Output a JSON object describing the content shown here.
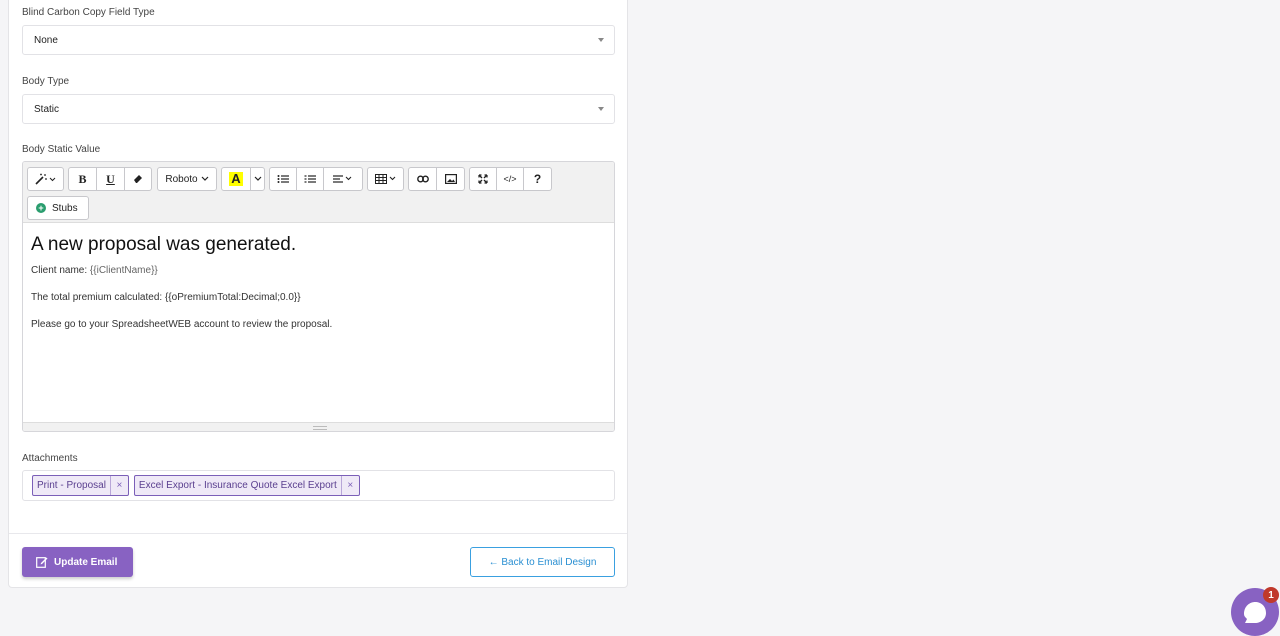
{
  "bcc": {
    "label": "Blind Carbon Copy Field Type",
    "value": "None"
  },
  "body_type": {
    "label": "Body Type",
    "value": "Static"
  },
  "body_static": {
    "label": "Body Static Value",
    "toolbar": {
      "font": "Roboto",
      "highlight_letter": "A",
      "help": "?",
      "code": "</>",
      "bold": "B",
      "underline": "U",
      "stubs": "Stubs"
    },
    "content": {
      "heading": "A new proposal was generated.",
      "line1_prefix": "Client name: ",
      "line1_var": "{{iClientName}}",
      "line2": "The total premium calculated: {{oPremiumTotal:Decimal;0.0}}",
      "line3": "Please go to your SpreadsheetWEB account to review the proposal."
    }
  },
  "attachments": {
    "label": "Attachments",
    "items": [
      {
        "label": "Print - Proposal",
        "remove": "×"
      },
      {
        "label": "Excel Export - Insurance Quote Excel Export",
        "remove": "×"
      }
    ]
  },
  "actions": {
    "update_label": "Update Email",
    "back_label": "← Back to Email Design"
  },
  "chat": {
    "badge": "1"
  },
  "colors": {
    "accent": "#8862c2",
    "link": "#2a8fd2",
    "badge": "#c0392b"
  }
}
